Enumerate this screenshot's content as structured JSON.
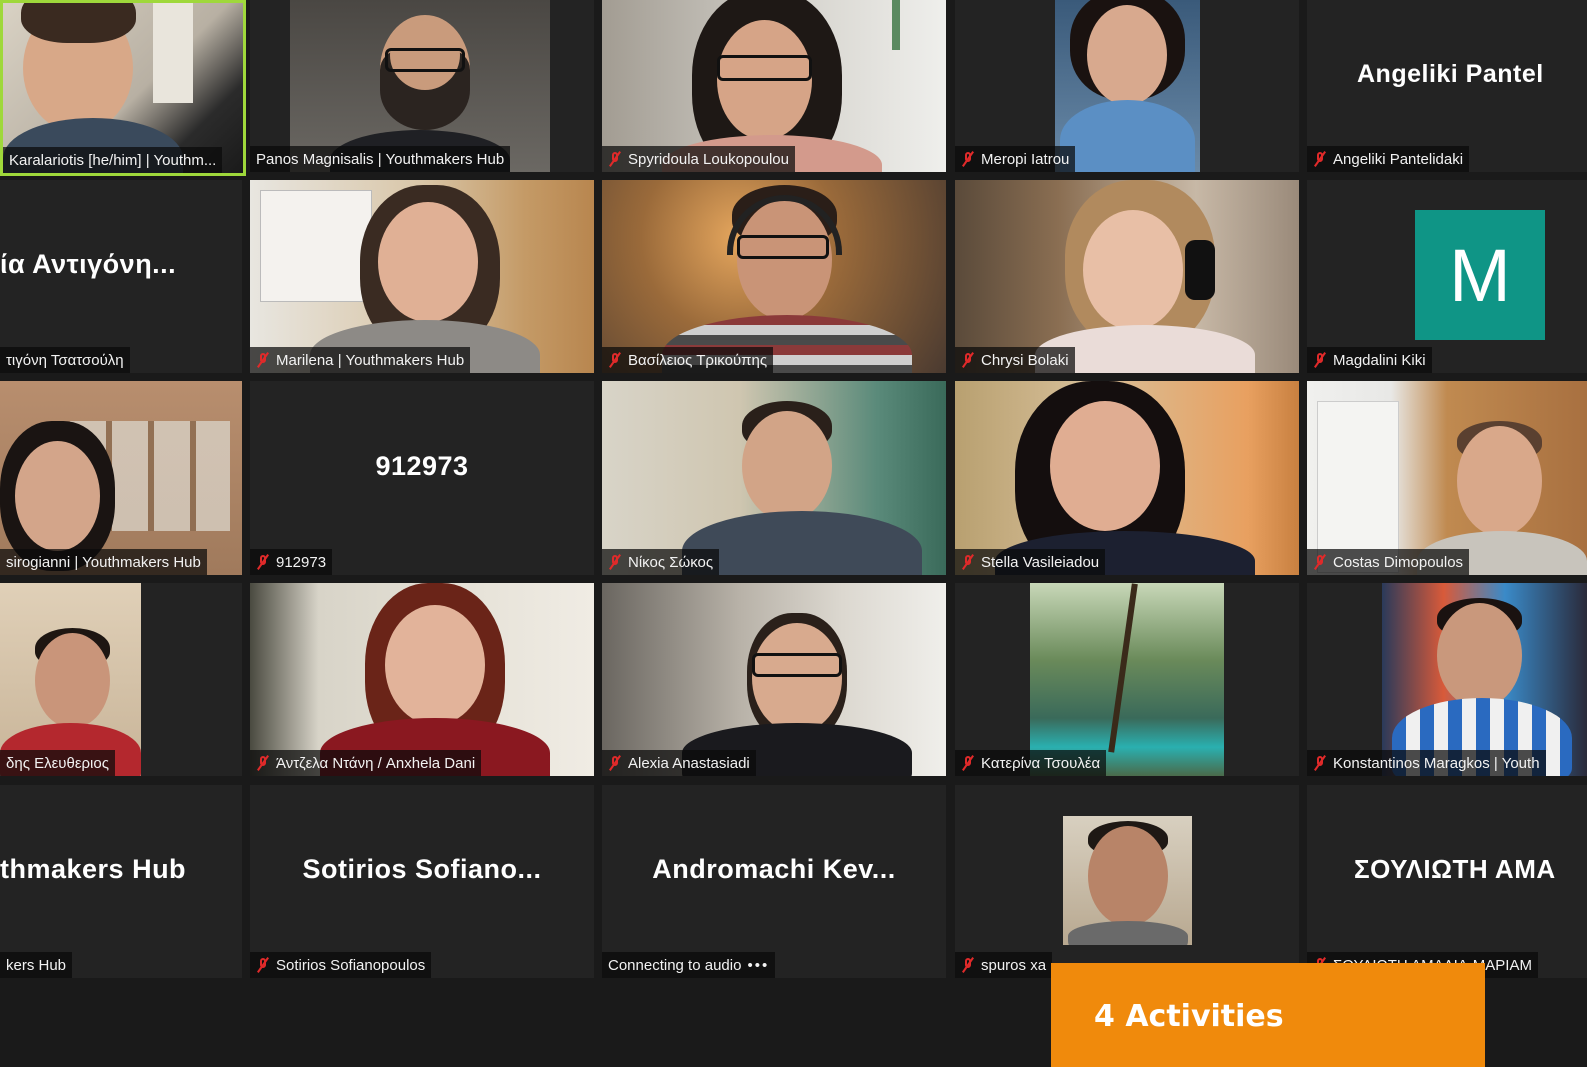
{
  "participants": [
    {
      "label": "Karalariotis [he/him] | Youthm...",
      "muted": false
    },
    {
      "label": "Panos Magnisalis | Youthmakers Hub",
      "muted": false
    },
    {
      "label": "Spyridoula Loukopoulou",
      "muted": true
    },
    {
      "label": "Meropi Iatrou",
      "muted": true
    },
    {
      "label": "Angeliki Pantelidaki",
      "muted": true,
      "display_name": "Angeliki  Pantel"
    },
    {
      "label": "τιγόνη Τσατσούλη",
      "muted": false,
      "display_name": "ία Αντιγόνη..."
    },
    {
      "label": "Marilena | Youthmakers Hub",
      "muted": true
    },
    {
      "label": "Βασίλειος Τρικούπης",
      "muted": true
    },
    {
      "label": "Chrysi Bolaki",
      "muted": true
    },
    {
      "label": "Magdalini Kiki",
      "muted": true,
      "avatar_letter": "M"
    },
    {
      "label": "sirogianni | Youthmakers Hub",
      "muted": false
    },
    {
      "label": "912973",
      "muted": true,
      "display_name": "912973"
    },
    {
      "label": "Νίκος Σώκος",
      "muted": true
    },
    {
      "label": "Stella Vasileiadou",
      "muted": true
    },
    {
      "label": "Costas Dimopoulos",
      "muted": true
    },
    {
      "label": "δης Ελευθεριος",
      "muted": false
    },
    {
      "label": "Άντζελα Ντάνη / Anxhela Dani",
      "muted": true
    },
    {
      "label": "Alexia Anastasiadi",
      "muted": true
    },
    {
      "label": "Κατερίνα Τσουλέα",
      "muted": true
    },
    {
      "label": "Konstantinos Maragkos | Youth",
      "muted": true
    },
    {
      "label": "kers Hub",
      "muted": false,
      "display_name": "thmakers Hub"
    },
    {
      "label": "Sotirios Sofianopoulos",
      "muted": true,
      "display_name": "Sotirios  Sofiano..."
    },
    {
      "label": "Connecting to audio",
      "muted": false,
      "display_name": "Andromachi  Kev..."
    },
    {
      "label": "spuros xa",
      "muted": true
    },
    {
      "label": "ΣΟΥΛΙΩΤΗ ΑΜΑΛΙΑ-ΜΑΡΙΑΜ",
      "muted": true,
      "display_name": "ΣΟΥΛΙΩΤΗ  ΑΜΑ"
    }
  ],
  "connecting_dots": "•••",
  "banner": {
    "text": "4 Activities"
  },
  "colors": {
    "accent": "#f08a0c",
    "active_speaker": "#9fd83b",
    "avatar": "#0f9586",
    "mute": "#e02a2a"
  }
}
